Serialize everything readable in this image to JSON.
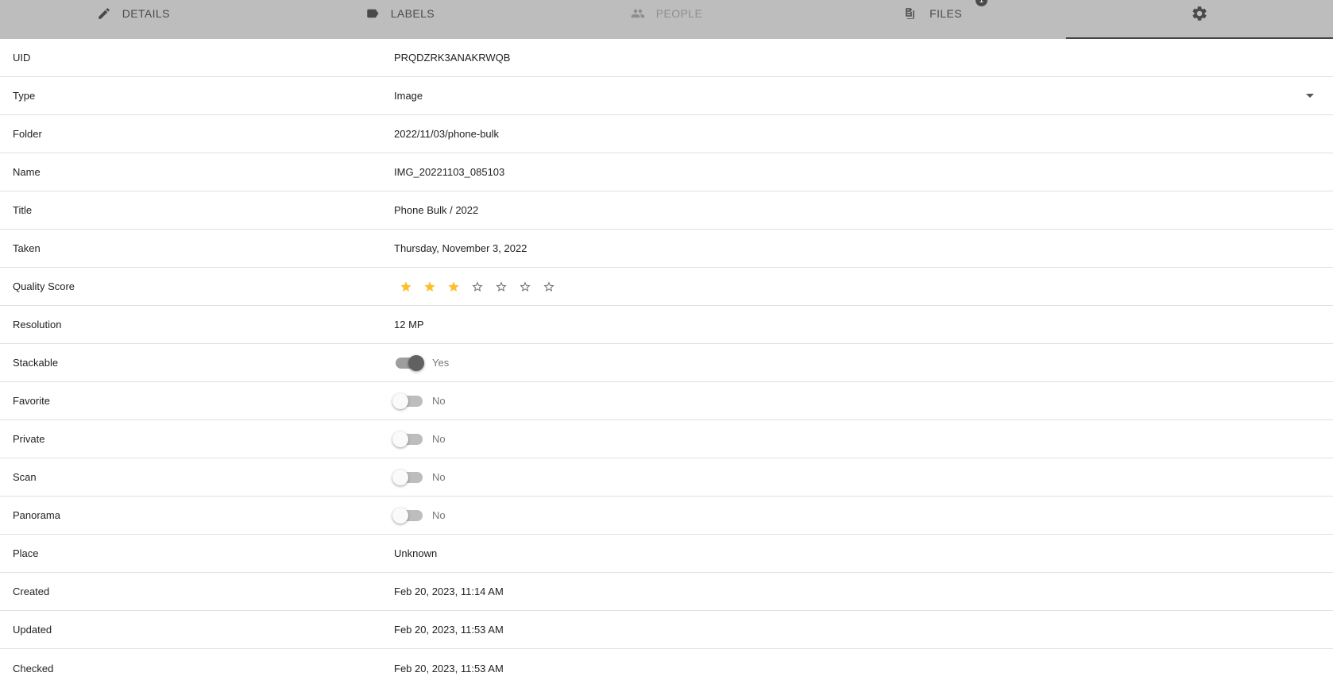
{
  "tabs": [
    {
      "label": "DETAILS",
      "icon": "pencil-icon",
      "state": "normal"
    },
    {
      "label": "LABELS",
      "icon": "label-tag-icon",
      "state": "normal"
    },
    {
      "label": "PEOPLE",
      "icon": "people-icon",
      "state": "disabled"
    },
    {
      "label": "FILES",
      "icon": "files-icon",
      "badge": "1",
      "state": "normal"
    },
    {
      "label": "",
      "icon": "gear-icon",
      "state": "active"
    }
  ],
  "fields": {
    "uid": {
      "label": "UID",
      "value": "PRQDZRK3ANAKRWQB"
    },
    "type": {
      "label": "Type",
      "value": "Image"
    },
    "folder": {
      "label": "Folder",
      "value": "2022/11/03/phone-bulk"
    },
    "name": {
      "label": "Name",
      "value": "IMG_20221103_085103"
    },
    "title": {
      "label": "Title",
      "value": "Phone Bulk / 2022"
    },
    "taken": {
      "label": "Taken",
      "value": "Thursday, November 3, 2022"
    },
    "quality": {
      "label": "Quality Score",
      "rating": 3,
      "max": 7
    },
    "resolution": {
      "label": "Resolution",
      "value": "12 MP"
    },
    "stackable": {
      "label": "Stackable",
      "on": true,
      "text": "Yes"
    },
    "favorite": {
      "label": "Favorite",
      "on": false,
      "text": "No"
    },
    "private": {
      "label": "Private",
      "on": false,
      "text": "No"
    },
    "scan": {
      "label": "Scan",
      "on": false,
      "text": "No"
    },
    "panorama": {
      "label": "Panorama",
      "on": false,
      "text": "No"
    },
    "place": {
      "label": "Place",
      "value": "Unknown"
    },
    "created": {
      "label": "Created",
      "value": "Feb 20, 2023, 11:14 AM"
    },
    "updated": {
      "label": "Updated",
      "value": "Feb 20, 2023, 11:53 AM"
    },
    "checked": {
      "label": "Checked",
      "value": "Feb 20, 2023, 11:53 AM"
    }
  },
  "colors": {
    "tabbar_bg": "#bdbdbd",
    "star_filled": "#fbc02d",
    "star_empty": "#757575"
  }
}
